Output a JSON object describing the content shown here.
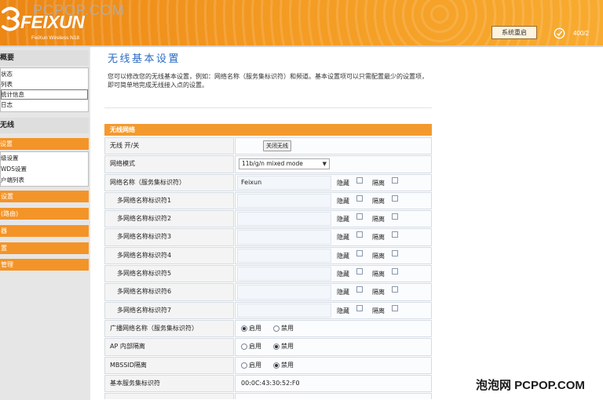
{
  "header": {
    "watermark": "PCPOP.COM",
    "logo_icon": "feixun-swirl-logo-icon",
    "logo_text": "FEIXUN",
    "logo_subtitle": "FeiXun Wireless N18",
    "restart_button_label": "系统重启",
    "hotline_icon": "check-circle-icon",
    "hotline_text": "400/2"
  },
  "sidebar": {
    "groups": [
      {
        "title": "概要",
        "items": [
          {
            "label": "状态"
          },
          {
            "label": "列表"
          },
          {
            "label": "统计信息",
            "focused": true
          },
          {
            "label": "日志"
          }
        ]
      },
      {
        "title": "无线",
        "items": [
          {
            "label": "设置",
            "selected": true
          },
          {
            "label": "级设置"
          },
          {
            "label": "WDS设置"
          },
          {
            "label": "户端列表"
          }
        ]
      }
    ],
    "collapsed_sections": [
      {
        "label": "设置"
      },
      {
        "label": "(路由)"
      },
      {
        "label": "器"
      },
      {
        "label": "置"
      },
      {
        "label": "管理"
      }
    ]
  },
  "main": {
    "title": "无线基本设置",
    "description": "您可以修改您的无线基本设置，例如：网络名称（服务集标识符）和频道。基本设置项可以只需配置最少的设置项，即可简单地完成无线接入点的设置。",
    "table": {
      "section_title": "无线网络",
      "flag_labels": {
        "hide": "隐藏",
        "isolate": "隔离"
      },
      "radio_labels": {
        "enable": "启用",
        "disable": "禁用"
      },
      "radio_power": {
        "label": "无线 开/关",
        "button_label": "关闭无线"
      },
      "network_mode": {
        "label": "网络模式",
        "value": "11b/g/n mixed mode"
      },
      "ssid": {
        "label": "网络名称（服务集标识符）",
        "value": "Feixun",
        "hidden": false,
        "isolated": false
      },
      "multi_ssid": [
        {
          "label": "多网络名称标识符1",
          "value": "",
          "hidden": false,
          "isolated": false
        },
        {
          "label": "多网络名称标识符2",
          "value": "",
          "hidden": false,
          "isolated": false
        },
        {
          "label": "多网络名称标识符3",
          "value": "",
          "hidden": false,
          "isolated": false
        },
        {
          "label": "多网络名称标识符4",
          "value": "",
          "hidden": false,
          "isolated": false
        },
        {
          "label": "多网络名称标识符5",
          "value": "",
          "hidden": false,
          "isolated": false
        },
        {
          "label": "多网络名称标识符6",
          "value": "",
          "hidden": false,
          "isolated": false
        },
        {
          "label": "多网络名称标识符7",
          "value": "",
          "hidden": false,
          "isolated": false
        }
      ],
      "broadcast_ssid": {
        "label": "广播网络名称（服务集标识符）",
        "enabled": true
      },
      "ap_isolation": {
        "label": "AP 内部隔离",
        "enabled": false
      },
      "mbssid_isolation": {
        "label": "MBSSID隔离",
        "enabled": false
      },
      "bssid": {
        "label": "基本服务集标识符",
        "value": "00:0C:43:30:52:F0"
      }
    }
  },
  "footer_watermark": "泡泡网 PCPOP.COM",
  "colors": {
    "header_orange": "#f39a22",
    "menu_orange": "#f39428",
    "table_header_orange": "#f39a2e",
    "title_blue": "#2b6cc4",
    "sidebar_gray": "#e6e6e6"
  }
}
